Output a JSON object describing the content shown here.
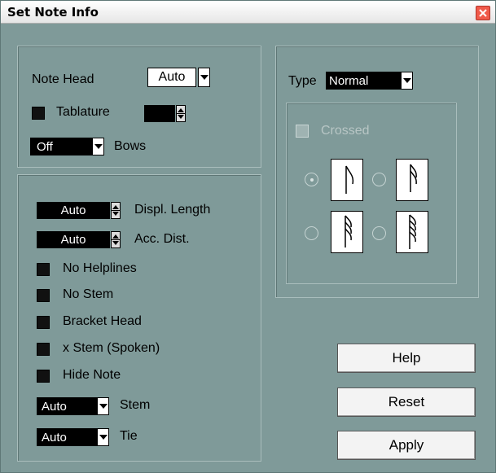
{
  "window": {
    "title": "Set Note Info",
    "close_icon": "close-icon"
  },
  "note_head": {
    "label": "Note Head",
    "value": "Auto"
  },
  "tablature": {
    "label": "Tablature",
    "checked": false
  },
  "bows": {
    "value": "Off",
    "label": "Bows"
  },
  "displ_length": {
    "value": "Auto",
    "label": "Displ. Length"
  },
  "acc_dist": {
    "value": "Auto",
    "label": "Acc. Dist."
  },
  "checkboxes": [
    {
      "label": "No Helplines"
    },
    {
      "label": "No Stem"
    },
    {
      "label": "Bracket Head"
    },
    {
      "label": "x Stem (Spoken)"
    },
    {
      "label": "Hide Note"
    }
  ],
  "stem": {
    "value": "Auto",
    "label": "Stem"
  },
  "tie": {
    "value": "Auto",
    "label": "Tie"
  },
  "type": {
    "label": "Type",
    "value": "Normal"
  },
  "crossed": {
    "label": "Crossed",
    "enabled": false
  },
  "buttons": {
    "help": "Help",
    "reset": "Reset",
    "apply": "Apply"
  },
  "colors": {
    "background": "#7f9a99",
    "field_dark": "#000000",
    "close": "#f05a4a"
  }
}
